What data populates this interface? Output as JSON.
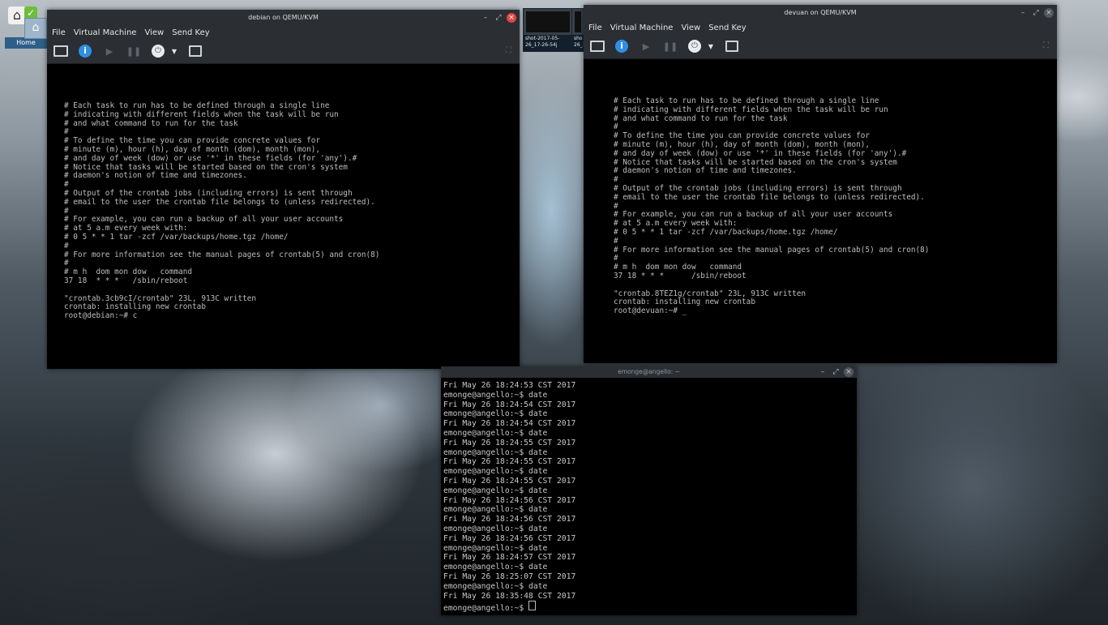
{
  "desktop": {
    "home_label": "Home",
    "thumbnails": [
      {
        "caption": "shot-2017-05-26_17-26-54j"
      },
      {
        "caption": "sho 26_1"
      }
    ]
  },
  "window_debian": {
    "title": "debian on QEMU/KVM",
    "menu": [
      "File",
      "Virtual Machine",
      "View",
      "Send Key"
    ],
    "console_text": "# Each task to run has to be defined through a single line\n# indicating with different fields when the task will be run\n# and what command to run for the task\n#\n# To define the time you can provide concrete values for\n# minute (m), hour (h), day of month (dom), month (mon),\n# and day of week (dow) or use '*' in these fields (for 'any').#\n# Notice that tasks will be started based on the cron's system\n# daemon's notion of time and timezones.\n#\n# Output of the crontab jobs (including errors) is sent through\n# email to the user the crontab file belongs to (unless redirected).\n#\n# For example, you can run a backup of all your user accounts\n# at 5 a.m every week with:\n# 0 5 * * 1 tar -zcf /var/backups/home.tgz /home/\n#\n# For more information see the manual pages of crontab(5) and cron(8)\n#\n# m h  dom mon dow   command\n37 18  * * *   /sbin/reboot\n\n\"crontab.3cb9cI/crontab\" 23L, 913C written\ncrontab: installing new crontab\nroot@debian:~# c"
  },
  "window_devuan": {
    "title": "devuan on QEMU/KVM",
    "menu": [
      "File",
      "Virtual Machine",
      "View",
      "Send Key"
    ],
    "console_text": "# Each task to run has to be defined through a single line\n# indicating with different fields when the task will be run\n# and what command to run for the task\n#\n# To define the time you can provide concrete values for\n# minute (m), hour (h), day of month (dom), month (mon),\n# and day of week (dow) or use '*' in these fields (for 'any').#\n# Notice that tasks will be started based on the cron's system\n# daemon's notion of time and timezones.\n#\n# Output of the crontab jobs (including errors) is sent through\n# email to the user the crontab file belongs to (unless redirected).\n#\n# For example, you can run a backup of all your user accounts\n# at 5 a.m every week with:\n# 0 5 * * 1 tar -zcf /var/backups/home.tgz /home/\n#\n# For more information see the manual pages of crontab(5) and cron(8)\n#\n# m h  dom mon dow   command\n37 18 * * *      /sbin/reboot\n\n\"crontab.8TEZ1g/crontab\" 23L, 913C written\ncrontab: installing new crontab\nroot@devuan:~# _"
  },
  "window_terminal": {
    "title": "emonge@angello: ~",
    "output": "Fri May 26 18:24:53 CST 2017\nemonge@angello:~$ date\nFri May 26 18:24:54 CST 2017\nemonge@angello:~$ date\nFri May 26 18:24:54 CST 2017\nemonge@angello:~$ date\nFri May 26 18:24:55 CST 2017\nemonge@angello:~$ date\nFri May 26 18:24:55 CST 2017\nemonge@angello:~$ date\nFri May 26 18:24:55 CST 2017\nemonge@angello:~$ date\nFri May 26 18:24:56 CST 2017\nemonge@angello:~$ date\nFri May 26 18:24:56 CST 2017\nemonge@angello:~$ date\nFri May 26 18:24:56 CST 2017\nemonge@angello:~$ date\nFri May 26 18:24:57 CST 2017\nemonge@angello:~$ date\nFri May 26 18:25:07 CST 2017\nemonge@angello:~$ date\nFri May 26 18:35:48 CST 2017\nemonge@angello:~$ "
  }
}
